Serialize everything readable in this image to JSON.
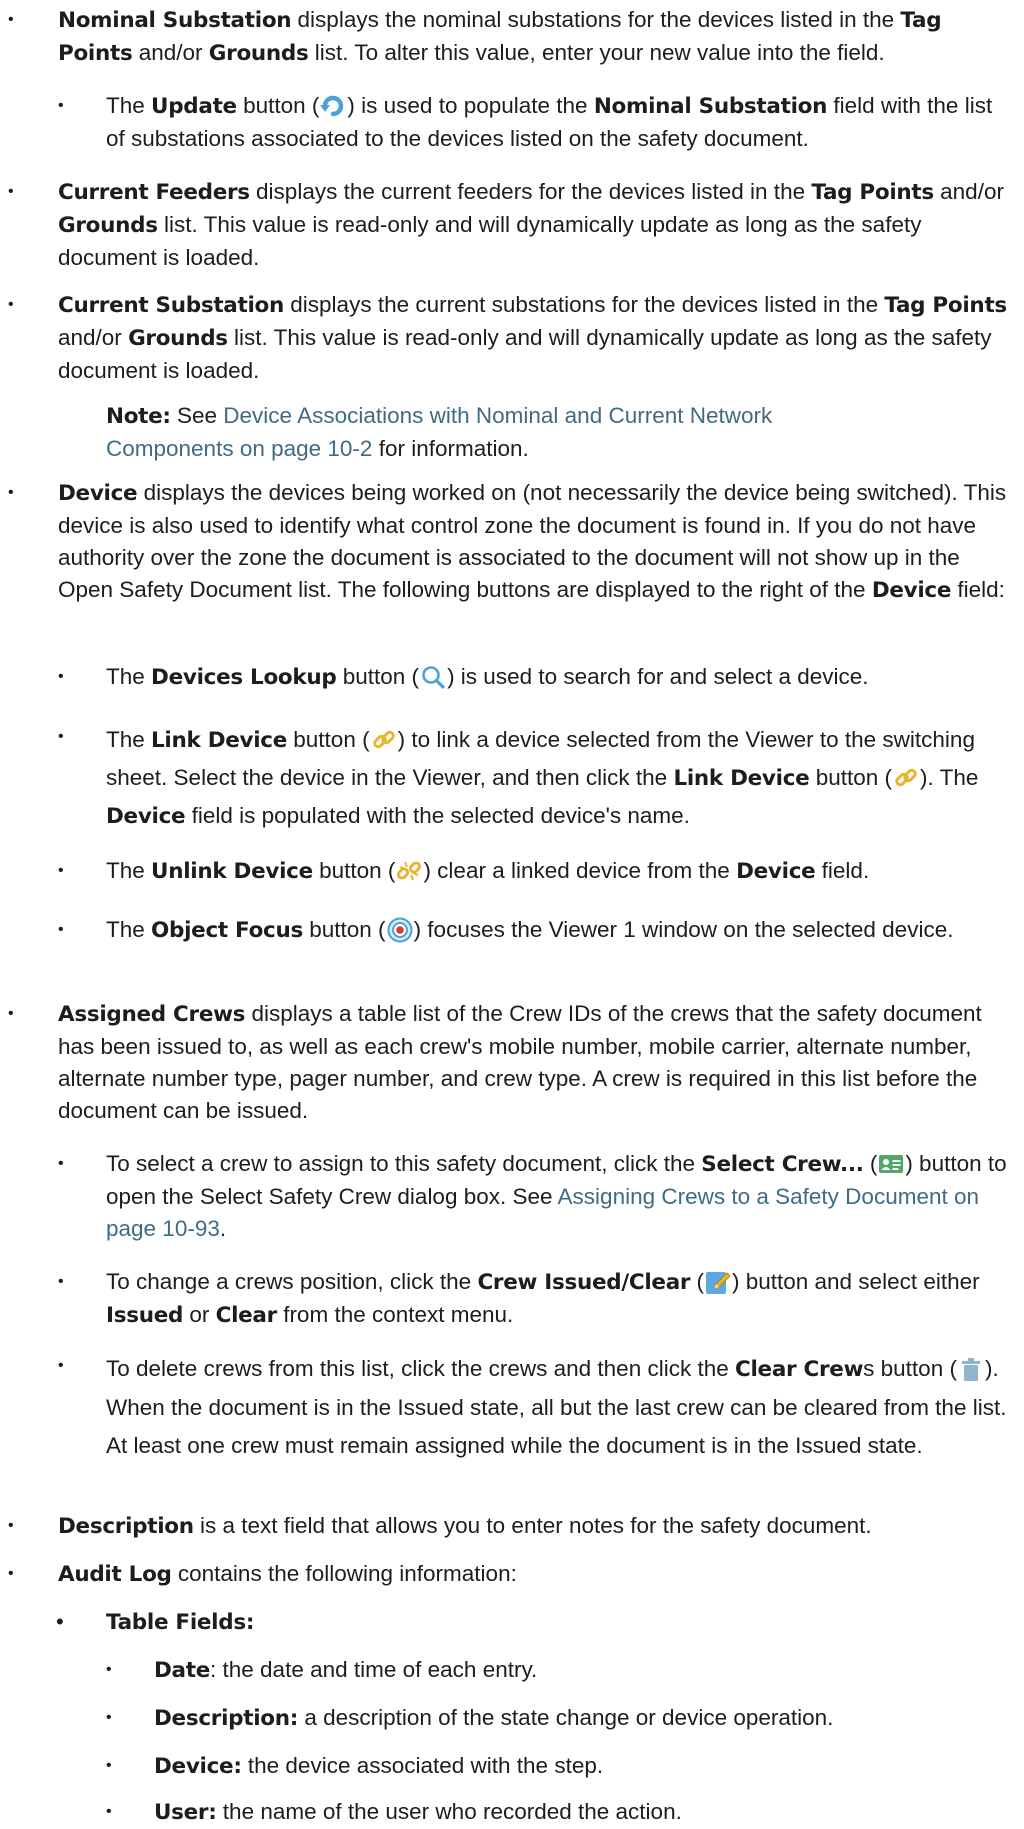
{
  "nominal_substation": {
    "term": "Nominal Substation",
    "t1": " displays the nominal substations for the devices listed in the ",
    "tag_points": "Tag Points",
    "t2": " and/or ",
    "grounds": "Grounds",
    "t3": " list. To alter this value, enter your new value into the field.",
    "update": {
      "t1": "The ",
      "term": "Update",
      "t2": " button (",
      "icon": "refresh-icon",
      "t3": ") is used to populate the ",
      "field": "Nominal Substation",
      "t4": " field with the list of substations associated to the devices listed on the safety document."
    }
  },
  "current_feeders": {
    "term": "Current Feeders",
    "t1": " displays the current feeders for the devices listed in the ",
    "tag_points": "Tag Points",
    "t2": " and/or ",
    "grounds": "Grounds",
    "t3": " list. This value is read-only and will dynamically update as long as the safety document is loaded."
  },
  "current_substation": {
    "term": "Current Substation",
    "t1": " displays the current substations for the devices listed in the ",
    "tag_points": "Tag Points",
    "t2": " and/or ",
    "grounds": "Grounds",
    "t3": " list. This value is read-only and will dynamically update as long as the safety document is loaded."
  },
  "note": {
    "label": "Note:",
    "t1": " See ",
    "link": "Device Associations with Nominal and Current Network Components on page 10-2",
    "t2": " for information."
  },
  "device": {
    "term": "Device",
    "t1": " displays the devices being worked on (not necessarily the device being switched). This device is also used to identify what control zone the document is found in. If you do not have authority over the zone the document is associated to the document will not show up in the Open Safety Document list. The following buttons are displayed to the right of the ",
    "field": "Device",
    "t2": " field:",
    "lookup": {
      "t1": "The ",
      "term": "Devices Lookup",
      "t2": " button (",
      "icon": "search-icon",
      "t3": ") is used to search for and select a device."
    },
    "link": {
      "t1": "The ",
      "term": "Link Device",
      "t2": " button (",
      "icon": "link-icon",
      "t3": ") to link a device selected from the Viewer to the switching sheet. Select the device in the Viewer, and then click the ",
      "term2": "Link Device",
      "t4": " button (",
      "t5": "). The ",
      "field": "Device",
      "t6": " field is populated with the selected device's name."
    },
    "unlink": {
      "t1": "The ",
      "term": "Unlink Device",
      "t2": " button (",
      "icon": "unlink-icon",
      "t3": ") clear a linked device from the ",
      "field": "Device",
      "t4": " field."
    },
    "focus": {
      "t1": "The ",
      "term": "Object Focus",
      "t2": " button (",
      "icon": "target-icon",
      "t3": ") focuses the Viewer 1 window on the selected device."
    }
  },
  "assigned_crews": {
    "term": "Assigned Crews",
    "t1": " displays a table list of the Crew IDs of the crews that the safety document has been issued to, as well as each crew's mobile number, mobile carrier, alternate number, alternate number type, pager number, and crew type. A crew is required in this list before the document can be issued.",
    "select": {
      "t1": "To select a crew to assign to this safety document, click the ",
      "term": "Select Crew...",
      "t2": " (",
      "icon": "crew-card-icon",
      "t3": ") button to open the Select Safety Crew dialog box. See ",
      "link": "Assigning Crews to a Safety Document on page 10-93",
      "t4": "."
    },
    "change": {
      "t1": "To change a crews position, click the ",
      "term": "Crew Issued/Clear",
      "t2": " (",
      "icon": "edit-pencil-icon",
      "t3": ") button and select either ",
      "issued": "Issued",
      "t4": " or ",
      "clear": "Clear",
      "t5": " from the context menu."
    },
    "delete": {
      "t1": "To delete crews from this list, click the crews and then click the ",
      "term": "Clear Crew",
      "t2": "s button (",
      "icon": "trash-icon",
      "t3": "). When the document is in the Issued state, all but the last crew can be cleared from the list. At least one crew must remain assigned while the document is in the Issued state."
    }
  },
  "description": {
    "term": "Description",
    "t1": " is a text field that allows you to enter notes for the safety document."
  },
  "audit_log": {
    "term": "Audit Log",
    "t1": " contains the following information:",
    "table_fields": "Table Fields:",
    "fields": [
      {
        "term": "Date",
        "text": ": the date and time of each entry."
      },
      {
        "term": "Description:",
        "text": " a description of the state change or device operation."
      },
      {
        "term": "Device:",
        "text": " the device associated with the step."
      },
      {
        "term": "User:",
        "text": " the name of the user who recorded the action."
      }
    ]
  },
  "colors": {
    "link": "#3f6b84",
    "text": "#1d1d1d",
    "icon_blue": "#4aa3d8",
    "icon_gold": "#e8b531",
    "icon_red": "#d83a2a",
    "icon_green": "#52a66a"
  }
}
